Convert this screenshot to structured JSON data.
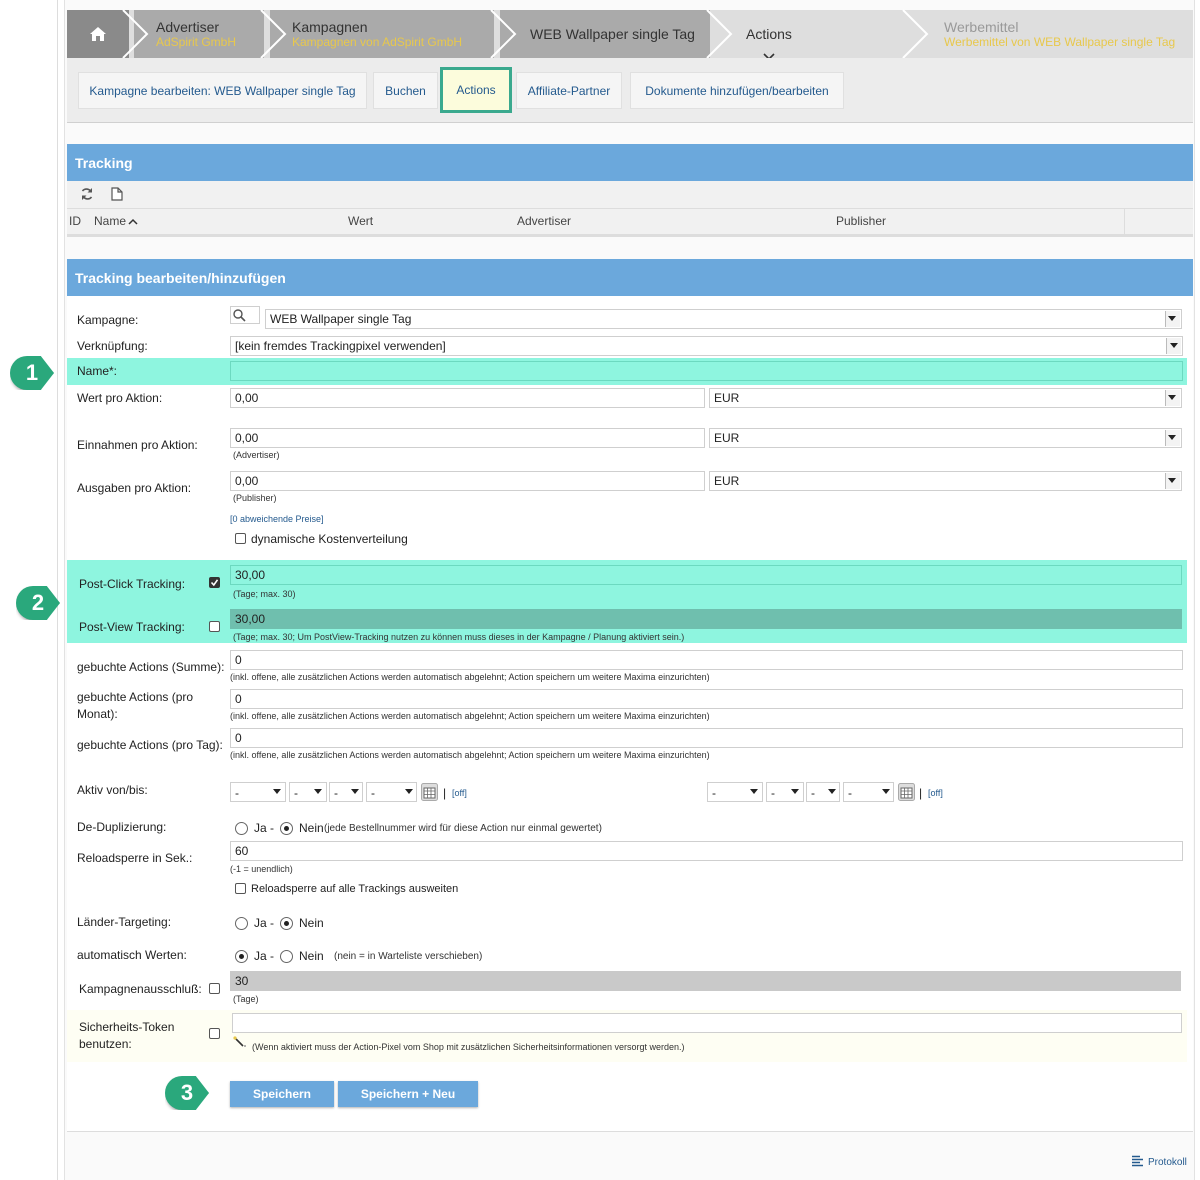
{
  "breadcrumb": [
    {
      "title": "Advertiser",
      "sub": "AdSpirit GmbH"
    },
    {
      "title": "Kampagnen",
      "sub": "Kampagnen von AdSpirit GmbH"
    },
    {
      "title": "WEB Wallpaper single Tag",
      "sub": ""
    },
    {
      "title": "Actions",
      "sub": ""
    },
    {
      "title": "Werbemittel",
      "sub": "Werbemittel von WEB Wallpaper single Tag"
    }
  ],
  "subnav": [
    "Kampagne bearbeiten: WEB Wallpaper single Tag",
    "Buchen",
    "Actions",
    "Affiliate-Partner",
    "Dokumente hinzufügen/bearbeiten"
  ],
  "tracking": {
    "title": "Tracking",
    "columns": [
      "ID",
      "Name",
      "Wert",
      "Advertiser",
      "Publisher"
    ]
  },
  "form": {
    "title": "Tracking bearbeiten/hinzufügen",
    "kampagne_label": "Kampagne:",
    "kampagne_value": "WEB Wallpaper single Tag",
    "verknuepfung_label": "Verknüpfung:",
    "verknuepfung_value": "[kein fremdes Trackingpixel verwenden]",
    "name_label": "Name*:",
    "name_value": "",
    "wert_label": "Wert pro Aktion:",
    "wert_value": "0,00",
    "wert_currency": "EUR",
    "einnahmen_label": "Einnahmen pro Aktion:",
    "einnahmen_value": "0,00",
    "einnahmen_currency": "EUR",
    "einnahmen_hint": "(Advertiser)",
    "ausgaben_label": "Ausgaben pro Aktion:",
    "ausgaben_value": "0,00",
    "ausgaben_currency": "EUR",
    "ausgaben_hint": "(Publisher)",
    "abweichende_link": "[0 abweichende Preise]",
    "dyn_label": "dynamische Kostenverteilung",
    "postclick_label": "Post-Click Tracking:",
    "postclick_value": "30,00",
    "postclick_hint": "(Tage; max. 30)",
    "postview_label": "Post-View Tracking:",
    "postview_value": "30,00",
    "postview_hint": "(Tage; max. 30; Um PostView-Tracking nutzen zu können muss dieses in der Kampagne / Planung aktiviert sein.)",
    "summe_label": "gebuchte Actions (Summe):",
    "summe_value": "0",
    "monat_label1": "gebuchte Actions (pro",
    "monat_label2": "Monat):",
    "monat_value": "0",
    "tag_label": "gebuchte Actions (pro Tag):",
    "tag_value": "0",
    "actions_hint": "(inkl. offene, alle zusätzlichen Actions werden automatisch abgelehnt; Action speichern um weitere Maxima einzurichten)",
    "aktiv_label": "Aktiv von/bis:",
    "dash": "-",
    "off": "[off]",
    "dedup_label": "De-Duplizierung:",
    "ja": "Ja -",
    "nein": "Nein",
    "dedup_hint": "(jede Bestellnummer wird für diese Action nur einmal gewertet)",
    "reload_label": "Reloadsperre in Sek.:",
    "reload_value": "60",
    "reload_hint": "(-1 = unendlich)",
    "reload_all_label": "Reloadsperre auf alle Trackings ausweiten",
    "laender_label": "Länder-Targeting:",
    "auto_label": "automatisch Werten:",
    "auto_hint": "(nein = in Warteliste verschieben)",
    "ausschluss_label": "Kampagnenausschluß:",
    "ausschluss_value": "30",
    "ausschluss_hint": "(Tage)",
    "token_label1": "Sicherheits-Token",
    "token_label2": "benutzen:",
    "token_hint": "(Wenn aktiviert muss der Action-Pixel vom Shop mit zusätzlichen Sicherheitsinformationen versorgt werden.)",
    "save": "Speichern",
    "save_new": "Speichern + Neu"
  },
  "badges": [
    "1",
    "2",
    "3"
  ],
  "protokoll": "Protokoll",
  "colors": {
    "header": "#6ba8dc",
    "highlight": "#8ef5df",
    "badge": "#2aa87c",
    "link": "#245a8e"
  }
}
